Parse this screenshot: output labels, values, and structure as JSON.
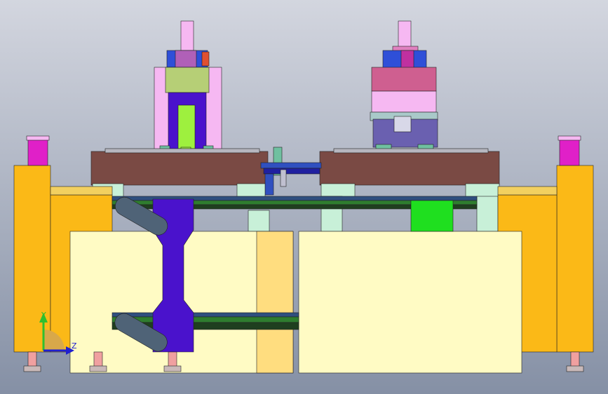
{
  "viewport": {
    "background_top": "#d3d6df",
    "background_bottom": "#8590a5"
  },
  "triad": {
    "y_label": "Y",
    "z_label": "Z",
    "y_color": "#2fbf2f",
    "z_color": "#2020d0",
    "arc_color": "#d8a84a"
  },
  "colors": {
    "frame_yellow": "#fbb917",
    "plate_brown": "#7a4a44",
    "light_yellow": "#fffbc4",
    "tan_panel": "#ffdd7f",
    "purple_arm": "#4a12cc",
    "mint": "#c8f0d8",
    "rail_green": "#2f7d2f",
    "bright_green": "#1fdf1f",
    "spindle_lime": "#9ef03e",
    "pink": "#f6b8f2",
    "rose": "#cf5f90",
    "olive": "#b6cf76",
    "blue": "#2f4fd8",
    "slate": "#4f6377",
    "motor_magenta": "#e020c8"
  }
}
